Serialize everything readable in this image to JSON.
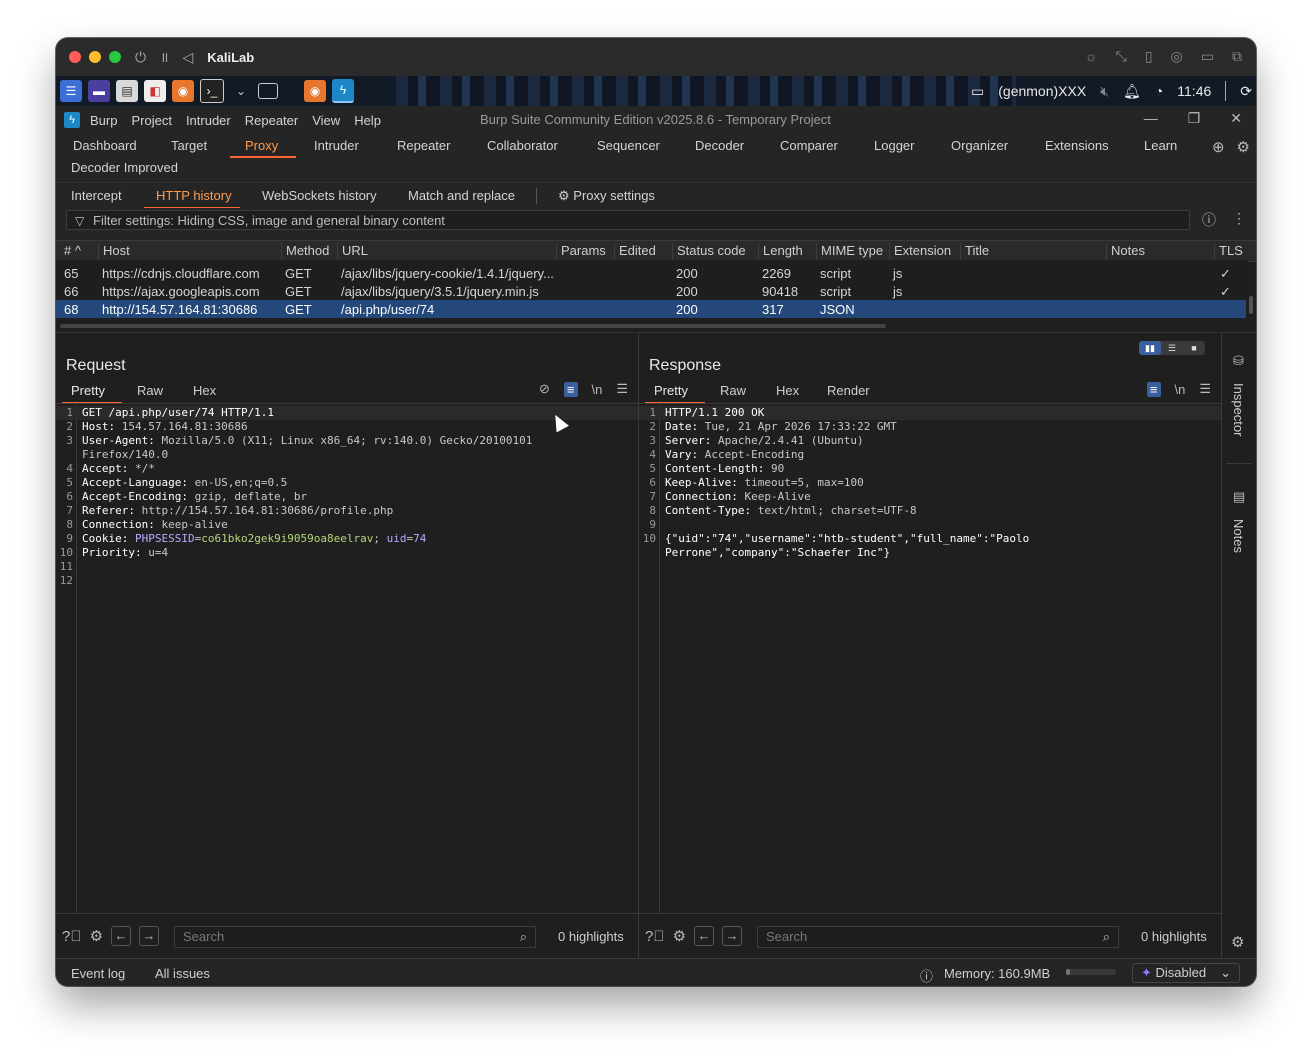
{
  "vm": {
    "title": "KaliLab"
  },
  "kali_panel": {
    "user": "(genmon)XXX",
    "time": "11:46"
  },
  "burp": {
    "menu": [
      "Burp",
      "Project",
      "Intruder",
      "Repeater",
      "View",
      "Help"
    ],
    "title": "Burp Suite Community Edition v2025.8.6 - Temporary Project",
    "main_tabs": [
      "Dashboard",
      "Target",
      "Proxy",
      "Intruder",
      "Repeater",
      "Collaborator",
      "Sequencer",
      "Decoder",
      "Comparer",
      "Logger",
      "Organizer",
      "Extensions",
      "Learn"
    ],
    "main_tabs_row2": "Decoder Improved",
    "sub_tabs": [
      "Intercept",
      "HTTP history",
      "WebSockets history",
      "Match and replace"
    ],
    "proxy_settings": "Proxy settings",
    "filter": "Filter settings: Hiding CSS, image and general binary content",
    "columns": [
      "# ^",
      "Host",
      "Method",
      "URL",
      "Params",
      "Edited",
      "Status code",
      "Length",
      "MIME type",
      "Extension",
      "Title",
      "Notes",
      "TLS"
    ],
    "rows": [
      {
        "num": "65",
        "host": "https://cdnjs.cloudflare.com",
        "method": "GET",
        "url": "/ajax/libs/jquery-cookie/1.4.1/jquery...",
        "status": "200",
        "length": "2269",
        "mime": "script",
        "ext": "js",
        "tls": "✓"
      },
      {
        "num": "66",
        "host": "https://ajax.googleapis.com",
        "method": "GET",
        "url": "/ajax/libs/jquery/3.5.1/jquery.min.js",
        "status": "200",
        "length": "90418",
        "mime": "script",
        "ext": "js",
        "tls": "✓"
      },
      {
        "num": "68",
        "host": "http://154.57.164.81:30686",
        "method": "GET",
        "url": "/api.php/user/74",
        "status": "200",
        "length": "317",
        "mime": "JSON",
        "ext": "",
        "tls": ""
      }
    ]
  },
  "request": {
    "title": "Request",
    "tabs": [
      "Pretty",
      "Raw",
      "Hex"
    ],
    "lines": [
      {
        "n": "1",
        "k": "GET /api.php/user/74 HTTP/1.1",
        "v": ""
      },
      {
        "n": "2",
        "k": "Host:",
        "v": " 154.57.164.81:30686"
      },
      {
        "n": "3",
        "k": "User-Agent:",
        "v": " Mozilla/5.0 (X11; Linux x86_64; rv:140.0) Gecko/20100101"
      },
      {
        "n": "",
        "k": "",
        "v": "Firefox/140.0"
      },
      {
        "n": "4",
        "k": "Accept:",
        "v": " */*"
      },
      {
        "n": "5",
        "k": "Accept-Language:",
        "v": " en-US,en;q=0.5"
      },
      {
        "n": "6",
        "k": "Accept-Encoding:",
        "v": " gzip, deflate, br"
      },
      {
        "n": "7",
        "k": "Referer:",
        "v": " http://154.57.164.81:30686/profile.php"
      },
      {
        "n": "8",
        "k": "Connection:",
        "v": " keep-alive"
      },
      {
        "n": "10",
        "k": "Priority:",
        "v": " u=4"
      },
      {
        "n": "11",
        "k": "",
        "v": ""
      },
      {
        "n": "12",
        "k": "",
        "v": ""
      }
    ],
    "cookie": {
      "n": "9",
      "k": "Cookie:",
      "name": " PHPSESSID",
      "eq": "=",
      "value": "co61bko2gek9i9059oa8eelrav",
      "sep": "; ",
      "uid_name": "uid",
      "uid_eq": "=",
      "uid_value": "74"
    },
    "search_placeholder": "Search",
    "highlights": "0 highlights"
  },
  "response": {
    "title": "Response",
    "tabs": [
      "Pretty",
      "Raw",
      "Hex",
      "Render"
    ],
    "lines": [
      {
        "n": "1",
        "k": "HTTP/1.1 200 OK",
        "v": ""
      },
      {
        "n": "2",
        "k": "Date:",
        "v": " Tue, 21 Apr 2026 17:33:22 GMT"
      },
      {
        "n": "3",
        "k": "Server:",
        "v": " Apache/2.4.41 (Ubuntu)"
      },
      {
        "n": "4",
        "k": "Vary:",
        "v": " Accept-Encoding"
      },
      {
        "n": "5",
        "k": "Content-Length:",
        "v": " 90"
      },
      {
        "n": "6",
        "k": "Keep-Alive:",
        "v": " timeout=5, max=100"
      },
      {
        "n": "7",
        "k": "Connection:",
        "v": " Keep-Alive"
      },
      {
        "n": "8",
        "k": "Content-Type:",
        "v": " text/html; charset=UTF-8"
      },
      {
        "n": "9",
        "k": "",
        "v": ""
      },
      {
        "n": "10",
        "k": "",
        "v": "{\"uid\":\"74\",\"username\":\"htb-student\",\"full_name\":\"Paolo"
      },
      {
        "n": "",
        "k": "",
        "v": "Perrone\",\"company\":\"Schaefer Inc\"}"
      }
    ],
    "search_placeholder": "Search",
    "highlights": "0 highlights"
  },
  "side_rail": {
    "inspector": "Inspector",
    "notes": "Notes"
  },
  "statusbar": {
    "event_log": "Event log",
    "all_issues": "All issues",
    "memory": "Memory: 160.9MB",
    "ai": "Disabled"
  }
}
